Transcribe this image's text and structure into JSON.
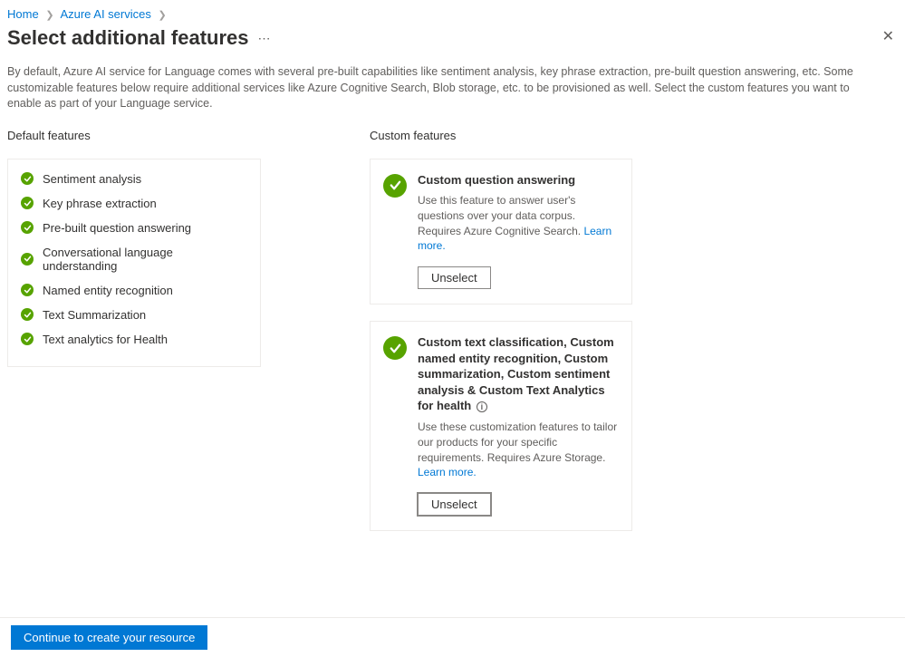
{
  "breadcrumb": {
    "home": "Home",
    "services": "Azure AI services"
  },
  "page": {
    "title": "Select additional features",
    "intro": "By default, Azure AI service for Language comes with several pre-built capabilities like sentiment analysis, key phrase extraction, pre-built question answering, etc. Some customizable features below require additional services like Azure Cognitive Search, Blob storage, etc. to be provisioned as well. Select the custom features you want to enable as part of your Language service."
  },
  "default_features": {
    "header": "Default features",
    "items": [
      "Sentiment analysis",
      "Key phrase extraction",
      "Pre-built question answering",
      "Conversational language understanding",
      "Named entity recognition",
      "Text Summarization",
      "Text analytics for Health"
    ]
  },
  "custom_features": {
    "header": "Custom features",
    "cards": [
      {
        "title": "Custom question answering",
        "desc_prefix": "Use this feature to answer user's questions over your data corpus. Requires Azure Cognitive Search. ",
        "learn_more": "Learn more.",
        "button": "Unselect"
      },
      {
        "title": "Custom text classification, Custom named entity recognition, Custom summarization, Custom sentiment analysis & Custom Text Analytics for health",
        "desc_prefix": "Use these customization features to tailor our products for your specific requirements. Requires Azure Storage. ",
        "learn_more": "Learn more.",
        "button": "Unselect"
      }
    ]
  },
  "footer": {
    "continue": "Continue to create your resource"
  }
}
